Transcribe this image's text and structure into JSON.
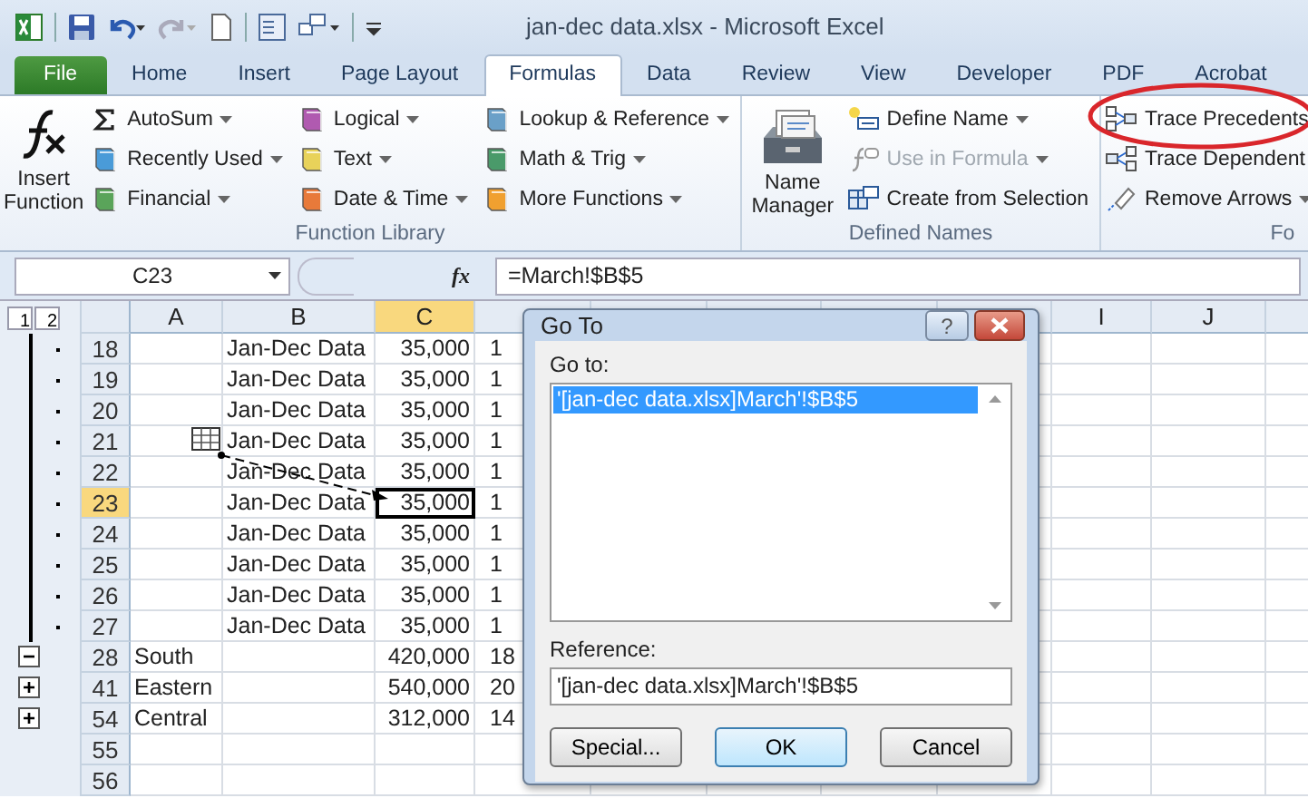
{
  "title_bar": {
    "title": "jan-dec data.xlsx  -  Microsoft Excel"
  },
  "tabs": [
    {
      "label": "File",
      "kind": "file",
      "selected": false
    },
    {
      "label": "Home",
      "kind": "tab",
      "selected": false
    },
    {
      "label": "Insert",
      "kind": "tab",
      "selected": false
    },
    {
      "label": "Page Layout",
      "kind": "tab",
      "selected": false
    },
    {
      "label": "Formulas",
      "kind": "tab",
      "selected": true
    },
    {
      "label": "Data",
      "kind": "tab",
      "selected": false
    },
    {
      "label": "Review",
      "kind": "tab",
      "selected": false
    },
    {
      "label": "View",
      "kind": "tab",
      "selected": false
    },
    {
      "label": "Developer",
      "kind": "tab",
      "selected": false
    },
    {
      "label": "PDF",
      "kind": "tab",
      "selected": false
    },
    {
      "label": "Acrobat",
      "kind": "tab",
      "selected": false
    }
  ],
  "ribbon": {
    "groups": [
      {
        "label": "Function Library",
        "large": {
          "label": "Insert Function"
        },
        "columns": [
          [
            {
              "label": "AutoSum",
              "dropdown": true,
              "disabled": false
            },
            {
              "label": "Recently Used",
              "dropdown": true,
              "disabled": false
            },
            {
              "label": "Financial",
              "dropdown": true,
              "disabled": false
            }
          ],
          [
            {
              "label": "Logical",
              "dropdown": true,
              "disabled": false
            },
            {
              "label": "Text",
              "dropdown": true,
              "disabled": false
            },
            {
              "label": "Date & Time",
              "dropdown": true,
              "disabled": false
            }
          ],
          [
            {
              "label": "Lookup & Reference",
              "dropdown": true,
              "disabled": false
            },
            {
              "label": "Math & Trig",
              "dropdown": true,
              "disabled": false
            },
            {
              "label": "More Functions",
              "dropdown": true,
              "disabled": false
            }
          ]
        ]
      },
      {
        "label": "Defined Names",
        "large": {
          "label": "Name Manager"
        },
        "columns": [
          [
            {
              "label": "Define Name",
              "dropdown": true,
              "disabled": false
            },
            {
              "label": "Use in Formula",
              "dropdown": true,
              "disabled": true
            },
            {
              "label": "Create from Selection",
              "dropdown": false,
              "disabled": false
            }
          ]
        ]
      },
      {
        "label": "Fo",
        "columns": [
          [
            {
              "label": "Trace Precedents",
              "dropdown": false,
              "disabled": false
            },
            {
              "label": "Trace Dependent",
              "dropdown": false,
              "disabled": false
            },
            {
              "label": "Remove Arrows",
              "dropdown": true,
              "disabled": false
            }
          ]
        ]
      }
    ]
  },
  "formula_bar": {
    "name_box": "C23",
    "fx": "fx",
    "formula": "=March!$B$5"
  },
  "outline_levels": [
    "1",
    "2"
  ],
  "grid": {
    "columns": [
      {
        "label": "A",
        "selected": false
      },
      {
        "label": "B",
        "selected": false
      },
      {
        "label": "C",
        "selected": true
      },
      {
        "selected": false
      },
      {
        "selected": false
      },
      {
        "selected": false
      },
      {
        "selected": false
      },
      {
        "selected": false
      },
      {
        "label": "I",
        "selected": false
      },
      {
        "label": "J",
        "selected": false
      },
      {
        "selected": false
      }
    ],
    "rows": [
      {
        "number": "18",
        "selected": false,
        "kind": "detail",
        "cells": [
          "",
          "Jan-Dec Data",
          "35,000",
          "1"
        ]
      },
      {
        "number": "19",
        "selected": false,
        "kind": "detail",
        "cells": [
          "",
          "Jan-Dec Data",
          "35,000",
          "1"
        ]
      },
      {
        "number": "20",
        "selected": false,
        "kind": "detail",
        "cells": [
          "",
          "Jan-Dec Data",
          "35,000",
          "1"
        ]
      },
      {
        "number": "21",
        "selected": false,
        "kind": "detail",
        "cells": [
          "",
          "Jan-Dec Data",
          "35,000",
          "1"
        ]
      },
      {
        "number": "22",
        "selected": false,
        "kind": "detail",
        "cells": [
          "",
          "Jan-Dec Data",
          "35,000",
          "1"
        ]
      },
      {
        "number": "23",
        "selected": true,
        "kind": "detail",
        "cells": [
          "",
          "Jan-Dec Data",
          "35,000",
          "1"
        ]
      },
      {
        "number": "24",
        "selected": false,
        "kind": "detail",
        "cells": [
          "",
          "Jan-Dec Data",
          "35,000",
          "1"
        ]
      },
      {
        "number": "25",
        "selected": false,
        "kind": "detail",
        "cells": [
          "",
          "Jan-Dec Data",
          "35,000",
          "1"
        ]
      },
      {
        "number": "26",
        "selected": false,
        "kind": "detail",
        "cells": [
          "",
          "Jan-Dec Data",
          "35,000",
          "1"
        ]
      },
      {
        "number": "27",
        "selected": false,
        "kind": "detail",
        "cells": [
          "",
          "Jan-Dec Data",
          "35,000",
          "1"
        ]
      },
      {
        "number": "28",
        "selected": false,
        "kind": "collapse",
        "button": "−",
        "cells": [
          "South",
          "",
          "420,000",
          "18"
        ]
      },
      {
        "number": "41",
        "selected": false,
        "kind": "expand",
        "button": "+",
        "cells": [
          "Eastern",
          "",
          "540,000",
          "20"
        ]
      },
      {
        "number": "54",
        "selected": false,
        "kind": "expand",
        "button": "+",
        "cells": [
          "Central",
          "",
          "312,000",
          "14"
        ]
      },
      {
        "number": "55",
        "selected": false,
        "kind": "plain",
        "cells": []
      },
      {
        "number": "56",
        "selected": false,
        "kind": "plain",
        "cells": []
      }
    ]
  },
  "dialog": {
    "title": "Go To",
    "help": "?",
    "go_to_label": "Go to:",
    "list": [
      {
        "text": "'[jan-dec data.xlsx]March'!$B$5",
        "selected": true
      }
    ],
    "reference_label": "Reference:",
    "reference_value": "'[jan-dec data.xlsx]March'!$B$5",
    "buttons": [
      {
        "label": "Special...",
        "default": false
      },
      {
        "label": "OK",
        "default": true
      },
      {
        "label": "Cancel",
        "default": false
      }
    ]
  }
}
